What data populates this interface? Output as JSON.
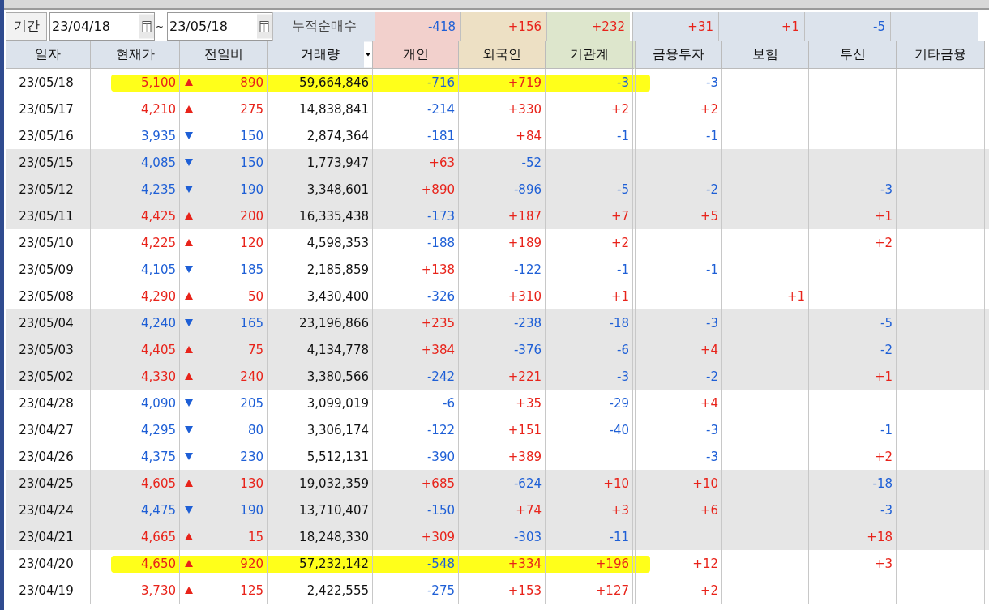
{
  "filter": {
    "period_label": "기간",
    "start_date": "23/04/18",
    "separator": "~",
    "end_date": "23/05/18",
    "summary_label": "누적순매수"
  },
  "summary": [
    "-418",
    "+156",
    "+232",
    "+31",
    "+1",
    "-5"
  ],
  "columns": [
    "일자",
    "현재가",
    "전일비",
    "거래량",
    "개인",
    "외국인",
    "기관계",
    "금융투자",
    "보험",
    "투신",
    "기타금융"
  ],
  "rows": [
    {
      "date": "23/05/18",
      "price": "5,100",
      "rising": true,
      "change": "890",
      "volume": "59,664,846",
      "individual": "-716",
      "foreign": "+719",
      "institution": "-3",
      "financial_investment": "-3",
      "highlighted": true
    },
    {
      "date": "23/05/17",
      "price": "4,210",
      "rising": true,
      "change": "275",
      "volume": "14,838,841",
      "individual": "-214",
      "foreign": "+330",
      "institution": "+2",
      "financial_investment": "+2",
      "highlighted": false
    },
    {
      "date": "23/05/16",
      "price": "3,935",
      "rising": false,
      "change": "150",
      "volume": "2,874,364",
      "individual": "-181",
      "foreign": "+84",
      "institution": "-1",
      "financial_investment": "-1",
      "highlighted": false
    },
    {
      "date": "23/05/15",
      "price": "4,085",
      "rising": false,
      "change": "150",
      "volume": "1,773,947",
      "individual": "+63",
      "foreign": "-52",
      "highlighted": false
    },
    {
      "date": "23/05/12",
      "price": "4,235",
      "rising": false,
      "change": "190",
      "volume": "3,348,601",
      "individual": "+890",
      "foreign": "-896",
      "institution": "-5",
      "financial_investment": "-2",
      "investment_trust": "-3",
      "highlighted": false
    },
    {
      "date": "23/05/11",
      "price": "4,425",
      "rising": true,
      "change": "200",
      "volume": "16,335,438",
      "individual": "-173",
      "foreign": "+187",
      "institution": "+7",
      "financial_investment": "+5",
      "investment_trust": "+1",
      "highlighted": false
    },
    {
      "date": "23/05/10",
      "price": "4,225",
      "rising": true,
      "change": "120",
      "volume": "4,598,353",
      "individual": "-188",
      "foreign": "+189",
      "institution": "+2",
      "investment_trust": "+2",
      "highlighted": false
    },
    {
      "date": "23/05/09",
      "price": "4,105",
      "rising": false,
      "change": "185",
      "volume": "2,185,859",
      "individual": "+138",
      "foreign": "-122",
      "institution": "-1",
      "financial_investment": "-1",
      "highlighted": false
    },
    {
      "date": "23/05/08",
      "price": "4,290",
      "rising": true,
      "change": "50",
      "volume": "3,430,400",
      "individual": "-326",
      "foreign": "+310",
      "institution": "+1",
      "insurance": "+1",
      "highlighted": false
    },
    {
      "date": "23/05/04",
      "price": "4,240",
      "rising": false,
      "change": "165",
      "volume": "23,196,866",
      "individual": "+235",
      "foreign": "-238",
      "institution": "-18",
      "financial_investment": "-3",
      "investment_trust": "-5",
      "highlighted": false
    },
    {
      "date": "23/05/03",
      "price": "4,405",
      "rising": true,
      "change": "75",
      "volume": "4,134,778",
      "individual": "+384",
      "foreign": "-376",
      "institution": "-6",
      "financial_investment": "+4",
      "investment_trust": "-2",
      "highlighted": false
    },
    {
      "date": "23/05/02",
      "price": "4,330",
      "rising": true,
      "change": "240",
      "volume": "3,380,566",
      "individual": "-242",
      "foreign": "+221",
      "institution": "-3",
      "financial_investment": "-2",
      "investment_trust": "+1",
      "highlighted": false
    },
    {
      "date": "23/04/28",
      "price": "4,090",
      "rising": false,
      "change": "205",
      "volume": "3,099,019",
      "individual": "-6",
      "foreign": "+35",
      "institution": "-29",
      "financial_investment": "+4",
      "highlighted": false
    },
    {
      "date": "23/04/27",
      "price": "4,295",
      "rising": false,
      "change": "80",
      "volume": "3,306,174",
      "individual": "-122",
      "foreign": "+151",
      "institution": "-40",
      "financial_investment": "-3",
      "investment_trust": "-1",
      "highlighted": false
    },
    {
      "date": "23/04/26",
      "price": "4,375",
      "rising": false,
      "change": "230",
      "volume": "5,512,131",
      "individual": "-390",
      "foreign": "+389",
      "financial_investment": "-3",
      "investment_trust": "+2",
      "highlighted": false
    },
    {
      "date": "23/04/25",
      "price": "4,605",
      "rising": true,
      "change": "130",
      "volume": "19,032,359",
      "individual": "+685",
      "foreign": "-624",
      "institution": "+10",
      "financial_investment": "+10",
      "investment_trust": "-18",
      "highlighted": false
    },
    {
      "date": "23/04/24",
      "price": "4,475",
      "rising": false,
      "change": "190",
      "volume": "13,710,407",
      "individual": "-150",
      "foreign": "+74",
      "institution": "+3",
      "financial_investment": "+6",
      "investment_trust": "-3",
      "highlighted": false
    },
    {
      "date": "23/04/21",
      "price": "4,665",
      "rising": true,
      "change": "15",
      "volume": "18,248,330",
      "individual": "+309",
      "foreign": "-303",
      "institution": "-11",
      "investment_trust": "+18",
      "highlighted": false
    },
    {
      "date": "23/04/20",
      "price": "4,650",
      "rising": true,
      "change": "920",
      "volume": "57,232,142",
      "individual": "-548",
      "foreign": "+334",
      "institution": "+196",
      "financial_investment": "+12",
      "investment_trust": "+3",
      "highlighted": true
    },
    {
      "date": "23/04/19",
      "price": "3,730",
      "rising": true,
      "change": "125",
      "volume": "2,422,555",
      "individual": "-275",
      "foreign": "+153",
      "institution": "+127",
      "financial_investment": "+2",
      "highlighted": false
    }
  ]
}
